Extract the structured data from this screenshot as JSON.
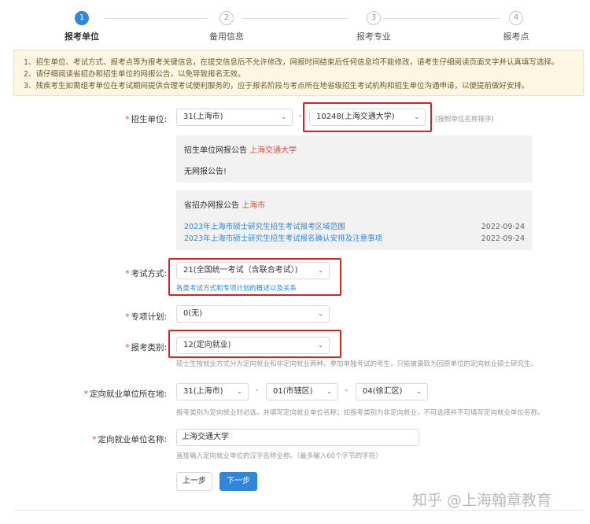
{
  "steps": [
    {
      "num": "1",
      "label": "报考单位",
      "active": true
    },
    {
      "num": "2",
      "label": "备用信息",
      "active": false
    },
    {
      "num": "3",
      "label": "报考专业",
      "active": false
    },
    {
      "num": "4",
      "label": "报考点",
      "active": false
    }
  ],
  "notice": [
    "1、招生单位、考试方式、报考点等为报考关键信息，在提交信息后不允许修改，网报时间结束后任何信息均不能修改，请考生仔细阅读页面文字并认真填写选择。",
    "2、请仔细阅读省招办和招生单位的网报公告，以免导致报名无效。",
    "3、残疾考生如需组考单位在考试期间提供合理考试便利服务的，应于报名阶段与考点所在地省级招生考试机构和招生单位沟通申请，以便提前做好安排。"
  ],
  "school": {
    "label": "招生单位:",
    "province": "31(上海市)",
    "unit": "10248(上海交通大学)",
    "hint": "(按照单位名称排序)"
  },
  "school_notice": {
    "title": "招生单位网报公告",
    "name": "上海交通大学",
    "text": "无网报公告!"
  },
  "province_notice": {
    "title": "省招办网报公告",
    "name": "上海市",
    "items": [
      {
        "text": "2023年上海市硕士研究生招生考试报考区域范围",
        "date": "2022-09-24"
      },
      {
        "text": "2023年上海市硕士研究生招生考试报名确认安排及注意事项",
        "date": "2022-09-24"
      }
    ]
  },
  "exam_mode": {
    "label": "考试方式:",
    "value": "21(全国统一考试（含联合考试）)",
    "link": "各类考试方式和专项计划的概述以及关系"
  },
  "special_plan": {
    "label": "专项计划:",
    "value": "0(无)"
  },
  "category": {
    "label": "报考类别:",
    "value": "12(定向就业)",
    "hint": "硕士生按就业方式分为定向就业和非定向就业两种。参加单独考试的考生，只能被录取为回原单位的定向就业硕士研究生。"
  },
  "location": {
    "label": "定向就业单位所在地:",
    "province": "31(上海市)",
    "city": "01(市辖区)",
    "district": "04(徐汇区)",
    "hint": "报考类别为定向就业时必选，并填写定向就业单位名称；如报考类别为非定向就业，不可选择并不可填写定向就业单位名称。"
  },
  "employer": {
    "label": "定向就业单位名称:",
    "value": "上海交通大学",
    "hint": "直接输入定向就业单位的汉字名称全称。（最多输入60个字节的字符）"
  },
  "buttons": {
    "prev": "上一步",
    "next": "下一步"
  },
  "watermark": "知乎 @上海翰章教育",
  "colors": {
    "primary": "#2e86de",
    "highlight": "#e02020",
    "notice_bg": "#fdf6e3"
  }
}
